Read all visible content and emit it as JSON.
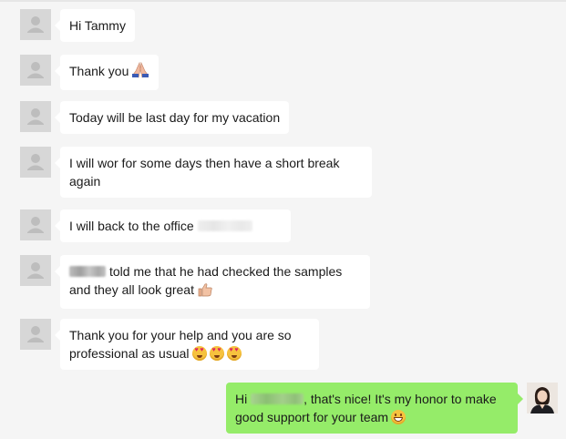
{
  "messages": [
    {
      "text": "Hi Tammy"
    },
    {
      "text": "Thank you",
      "icon": "folded-hands-icon"
    },
    {
      "text": "Today will be last day for my vacation"
    },
    {
      "text": "I will wor for some days then have a short break again"
    },
    {
      "text": "I will back to the office"
    },
    {
      "text": "told me that he had checked the samples and they all look great",
      "icon": "thumbs-up-icon"
    },
    {
      "text": "Thank you for your help and you are so professional as usual",
      "icons": [
        "heart-eyes-icon",
        "heart-eyes-icon",
        "heart-eyes-icon"
      ]
    }
  ],
  "my_message": {
    "prefix": "Hi ",
    "suffix": ", that's nice! It's my honor to make good support for your team",
    "icon": "grinning-face-icon"
  },
  "colors": {
    "background": "#f5f5f5",
    "incoming_bubble": "#ffffff",
    "outgoing_bubble": "#95ec69",
    "avatar_placeholder": "#d7d7d7"
  }
}
